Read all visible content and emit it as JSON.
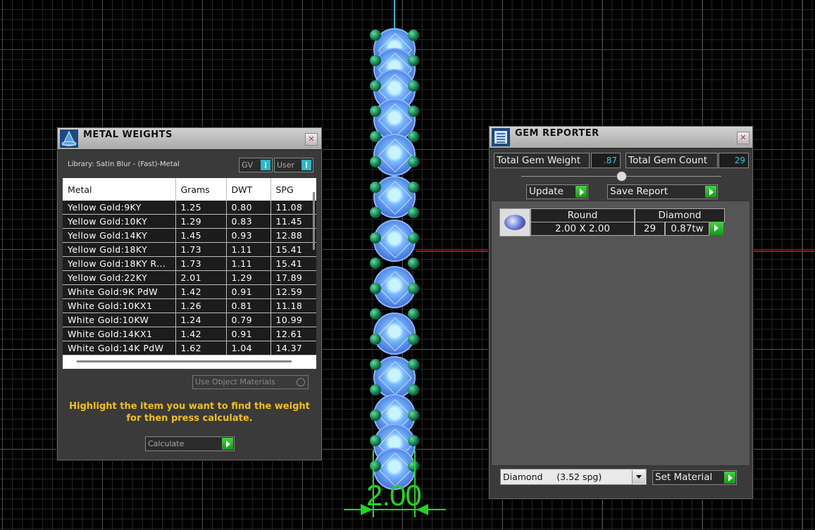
{
  "metal_weights": {
    "title": "METAL WEIGHTS",
    "library_label": "Library: Satin Blur - (Fast)-Metal",
    "gv_label": "GV",
    "user_label": "User",
    "columns": [
      "Metal",
      "Grams",
      "DWT",
      "SPG"
    ],
    "rows": [
      [
        "Yellow Gold:9KY",
        "1.25",
        "0.80",
        "11.08"
      ],
      [
        "Yellow Gold:10KY",
        "1.29",
        "0.83",
        "11.45"
      ],
      [
        "Yellow Gold:14KY",
        "1.45",
        "0.93",
        "12.88"
      ],
      [
        "Yellow Gold:18KY",
        "1.73",
        "1.11",
        "15.41"
      ],
      [
        "Yellow Gold:18KY R...",
        "1.73",
        "1.11",
        "15.41"
      ],
      [
        "Yellow Gold:22KY",
        "2.01",
        "1.29",
        "17.89"
      ],
      [
        "White Gold:9K PdW",
        "1.42",
        "0.91",
        "12.59"
      ],
      [
        "White Gold:10KX1",
        "1.26",
        "0.81",
        "11.18"
      ],
      [
        "White Gold:10KW",
        "1.24",
        "0.79",
        "10.99"
      ],
      [
        "White Gold:14KX1",
        "1.42",
        "0.91",
        "12.61"
      ],
      [
        "White Gold:14K PdW",
        "1.62",
        "1.04",
        "14.37"
      ]
    ],
    "use_object_materials": "Use Object Materials",
    "hint": "Highlight the item you want to find the weight for then press calculate.",
    "calculate_label": "Calculate",
    "close_symbol": "✕"
  },
  "gem_reporter": {
    "title": "GEM REPORTER",
    "total_gem_weight_label": "Total Gem Weight",
    "total_gem_weight_value": ".87",
    "total_gem_count_label": "Total Gem Count",
    "total_gem_count_value": "29",
    "update_label": "Update",
    "save_report_label": "Save Report",
    "gem_row": {
      "shape": "Round",
      "material": "Diamond",
      "size": "2.00 X 2.00",
      "count": "29",
      "weight": "0.87tw"
    },
    "material_select": "Diamond     (3.52 spg)",
    "set_material_label": "Set Material",
    "close_symbol": "✕"
  },
  "viewport": {
    "dimension_text": "2.00"
  },
  "colors": {
    "accent_cyan": "#2fc8e0",
    "go_green": "#1fb01f",
    "hint_yellow": "#f0c020",
    "dimension_green": "#23d323"
  }
}
